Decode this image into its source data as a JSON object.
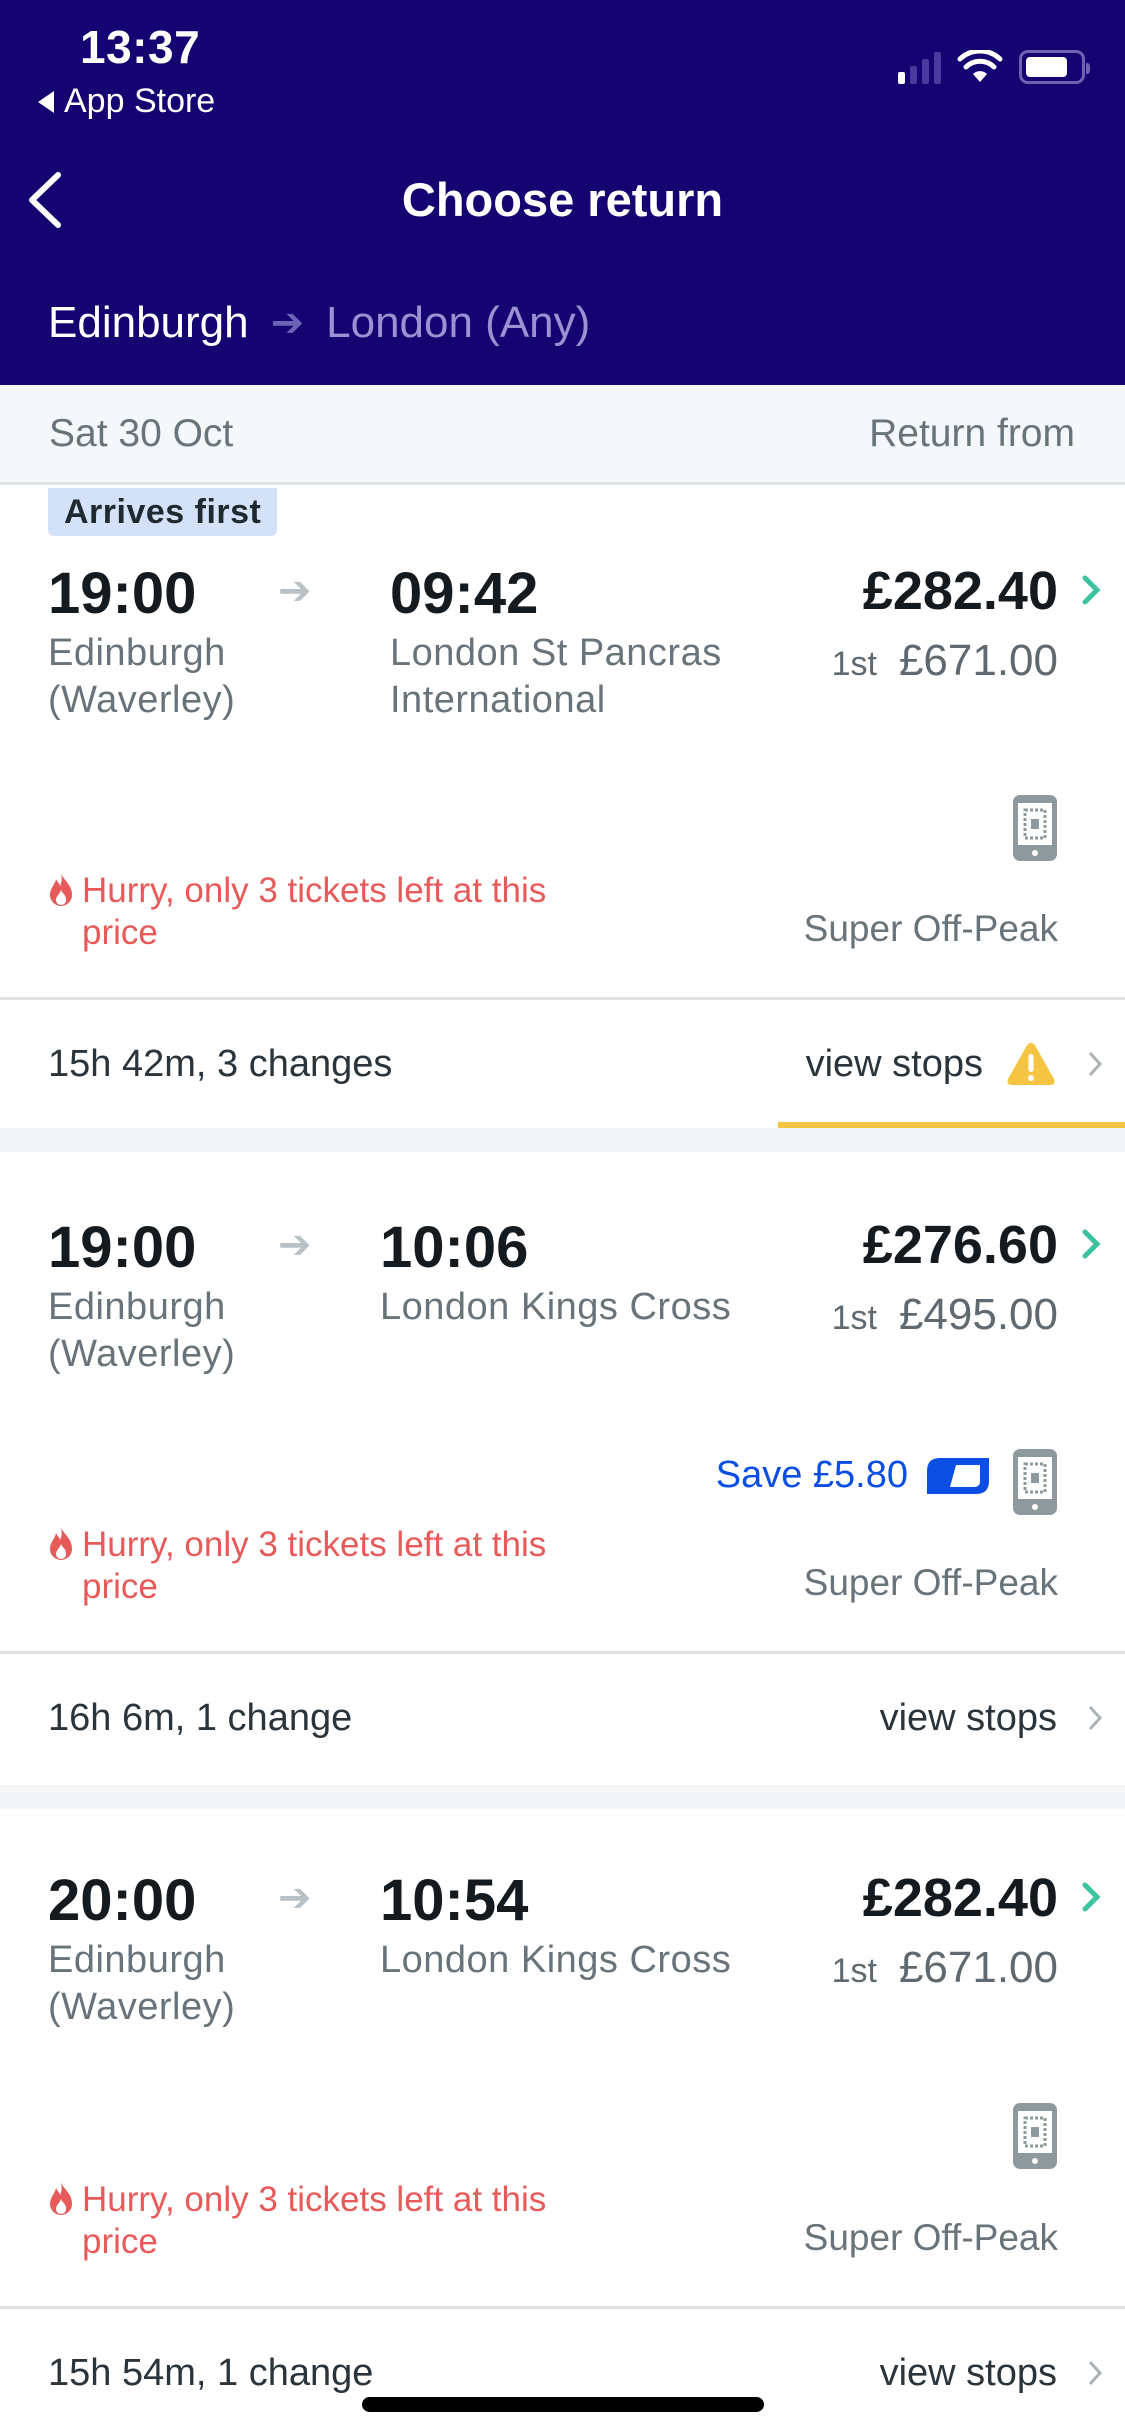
{
  "status_bar": {
    "time": "13:37",
    "back_app": "App Store",
    "signal_bars_active": 1,
    "signal_bars_total": 4,
    "battery_level_pct": 78
  },
  "nav": {
    "title": "Choose return",
    "back_icon": "chevron-left-icon"
  },
  "route": {
    "from": "Edinburgh",
    "to": "London (Any)",
    "arrow_icon": "arrow-right-icon"
  },
  "date_bar": {
    "date": "Sat 30 Oct",
    "right_label": "Return from"
  },
  "colors": {
    "header_bg": "#140370",
    "price_chevron": "#3ec3a0",
    "hurry_red": "#e85a5a",
    "save_blue": "#0a4ee4",
    "warning_yellow": "#f5c443",
    "badge_bg": "#d3e2f9"
  },
  "journeys": [
    {
      "badge": "Arrives first",
      "depart_time": "19:00",
      "arrive_time": "09:42",
      "depart_station": "Edinburgh (Waverley)",
      "arrive_station": "London St Pancras International",
      "price": "£282.40",
      "first_class_label": "1st",
      "first_class_price": "£671.00",
      "hurry": "Hurry, only 3 tickets left at this price",
      "fare_type": "Super Off-Peak",
      "mobile_ticket": true,
      "summary": "15h 42m, 3 changes",
      "view_stops": "view stops",
      "warning": true
    },
    {
      "depart_time": "19:00",
      "arrive_time": "10:06",
      "depart_station": "Edinburgh (Waverley)",
      "arrive_station": "London Kings Cross",
      "price": "£276.60",
      "first_class_label": "1st",
      "first_class_price": "£495.00",
      "save": "Save £5.80",
      "hurry": "Hurry, only 3 tickets left at this price",
      "fare_type": "Super Off-Peak",
      "mobile_ticket": true,
      "summary": "16h 6m, 1 change",
      "view_stops": "view stops",
      "warning": false
    },
    {
      "depart_time": "20:00",
      "arrive_time": "10:54",
      "depart_station": "Edinburgh (Waverley)",
      "arrive_station": "London Kings Cross",
      "price": "£282.40",
      "first_class_label": "1st",
      "first_class_price": "£671.00",
      "hurry": "Hurry, only 3 tickets left at this price",
      "fare_type": "Super Off-Peak",
      "mobile_ticket": true,
      "summary": "15h 54m, 1 change",
      "view_stops": "view stops",
      "warning": false
    }
  ]
}
